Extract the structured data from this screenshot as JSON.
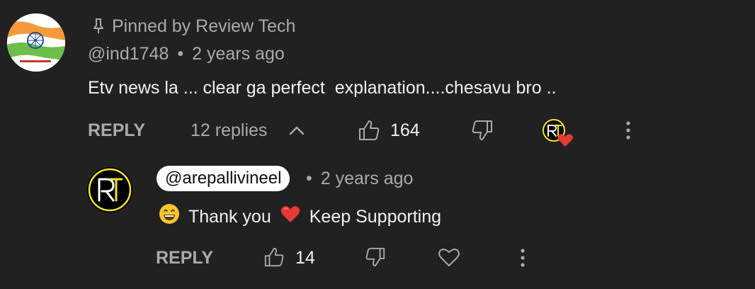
{
  "comment": {
    "pinned_label": "Pinned by Review Tech",
    "author": "@ind1748",
    "separator": "•",
    "timestamp": "2 years ago",
    "text": "Etv news la ... clear ga perfect  explanation....chesavu bro ..",
    "actions": {
      "reply_label": "REPLY",
      "replies_label": "12 replies",
      "like_count": "164"
    },
    "icons": [
      "pin-icon",
      "chevron-up-icon",
      "thumbs-up-icon",
      "thumbs-down-icon",
      "creator-heart-icon",
      "more-vert-icon"
    ]
  },
  "reply": {
    "author": "@arepallivineel",
    "separator": "•",
    "timestamp": "2 years ago",
    "text_part1": "Thank you",
    "text_part2": "Keep Supporting",
    "emojis": [
      "grinning-face",
      "red-heart"
    ],
    "actions": {
      "reply_label": "REPLY",
      "like_count": "14"
    },
    "icons": [
      "thumbs-up-icon",
      "thumbs-down-icon",
      "heart-icon",
      "more-vert-icon"
    ]
  },
  "colors": {
    "background": "#212121",
    "primary_text": "#f1f1f1",
    "secondary_text": "#aaaaaa",
    "heart_red": "#e53935",
    "rt_yellow": "#f2e52a"
  }
}
